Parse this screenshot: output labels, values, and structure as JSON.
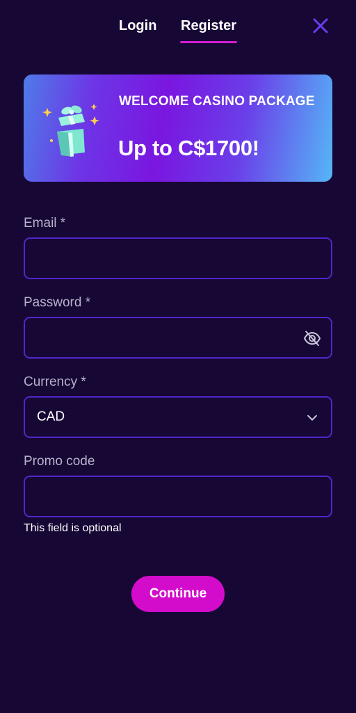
{
  "tabs": {
    "login": "Login",
    "register": "Register",
    "active": "Register"
  },
  "banner": {
    "title": "WELCOME CASINO PACKAGE",
    "amount": "Up to C$1700!"
  },
  "form": {
    "email": {
      "label": "Email *",
      "value": ""
    },
    "password": {
      "label": "Password *",
      "value": ""
    },
    "currency": {
      "label": "Currency *",
      "value": "CAD"
    },
    "promo": {
      "label": "Promo code",
      "value": "",
      "hint": "This field is optional"
    }
  },
  "actions": {
    "continue": "Continue"
  },
  "colors": {
    "background": "#170734",
    "accent": "#d30ccc",
    "field_border": "#5126c9",
    "close_icon": "#6a3cf0"
  },
  "icons": [
    "close-icon",
    "gift-icon",
    "eye-off-icon",
    "chevron-down-icon"
  ]
}
